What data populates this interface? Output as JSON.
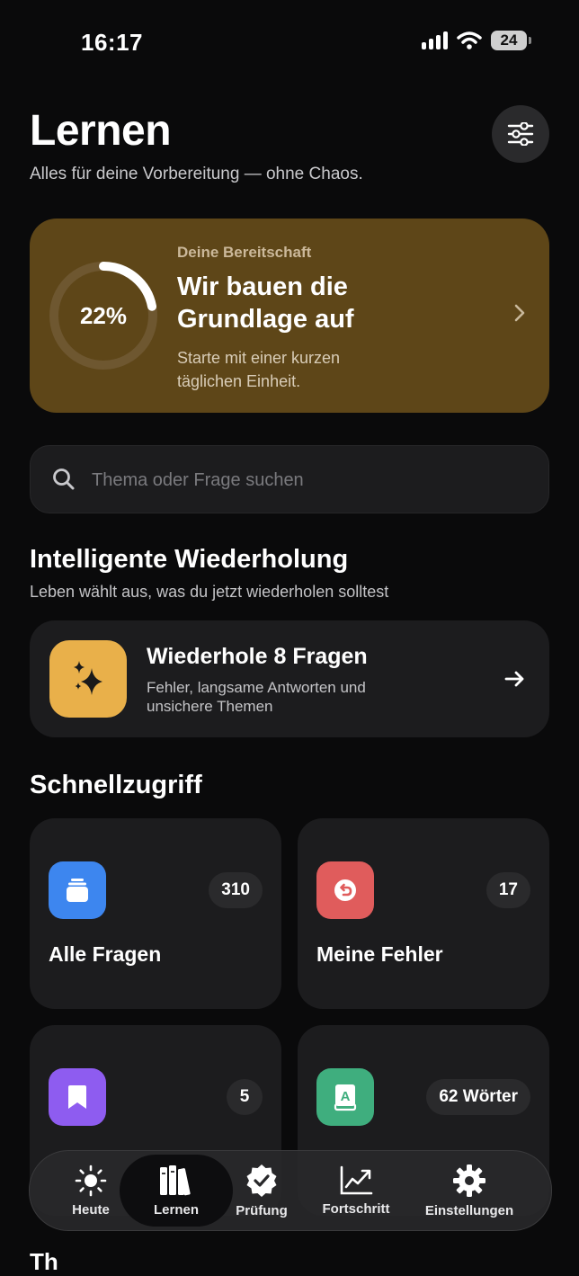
{
  "status_bar": {
    "time": "16:17",
    "battery": "24"
  },
  "header": {
    "title": "Lernen",
    "subtitle": "Alles für deine Vorbereitung — ohne Chaos."
  },
  "readiness": {
    "percent_label": "22%",
    "progress": 0.22,
    "kicker": "Deine Bereitschaft",
    "title": "Wir bauen die Grundlage auf",
    "description": "Starte mit einer kurzen täglichen Einheit."
  },
  "search": {
    "placeholder": "Thema oder Frage suchen",
    "value": ""
  },
  "smart_review": {
    "section_title": "Intelligente Wiederholung",
    "section_subtitle": "Leben wählt aus, was du jetzt wiederholen solltest",
    "card_title": "Wiederhole 8 Fragen",
    "card_description": "Fehler, langsame Antworten und unsichere Themen"
  },
  "quick_access": {
    "title": "Schnellzugriff",
    "tiles": [
      {
        "label": "Alle Fragen",
        "count": "310",
        "color": "#3d86ef",
        "icon": "stack-icon"
      },
      {
        "label": "Meine Fehler",
        "count": "17",
        "color": "#e05c5c",
        "icon": "undo-icon"
      },
      {
        "label": "",
        "count": "5",
        "color": "#8e5cf0",
        "icon": "bookmark-icon"
      },
      {
        "label": "",
        "count": "62 Wörter",
        "color": "#3fae7e",
        "icon": "dictionary-icon"
      }
    ]
  },
  "tabbar": {
    "tabs": [
      {
        "label": "Heute",
        "icon": "sun-icon"
      },
      {
        "label": "Lernen",
        "icon": "books-icon",
        "active": true
      },
      {
        "label": "Prüfung",
        "icon": "verified-badge-icon"
      },
      {
        "label": "Fortschritt",
        "icon": "chart-up-icon"
      },
      {
        "label": "Einstellungen",
        "icon": "gear-icon"
      }
    ]
  },
  "bottom_peek": "Th"
}
